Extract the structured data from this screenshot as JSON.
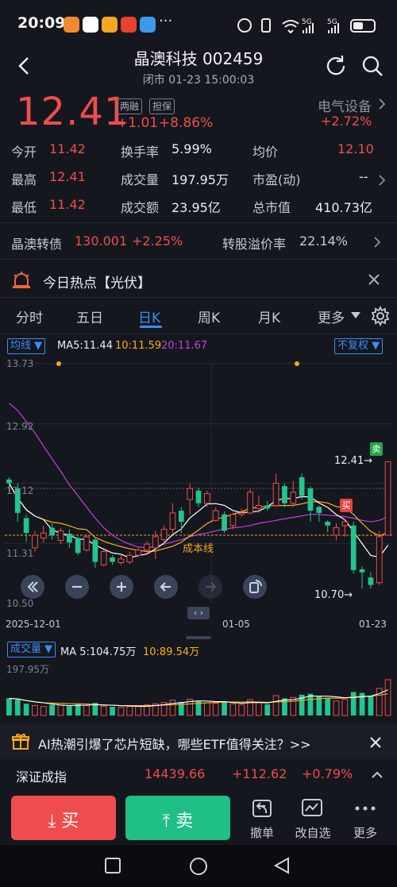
{
  "status_bar": {
    "time": "20:09",
    "battery": "5G"
  },
  "header": {
    "title": "晶澳科技 002459",
    "subtitle": "闭市 01-23 15:00:03"
  },
  "quote": {
    "price": "12.41",
    "change": "+1.01",
    "change_pct": "+8.86%",
    "tags": [
      "两融",
      "担保"
    ],
    "sector_name": "电气设备",
    "sector_change": "+2.72%",
    "stats": [
      {
        "label": "今开",
        "value": "11.42"
      },
      {
        "label": "换手率",
        "value": "5.99%"
      },
      {
        "label": "均价",
        "value": "12.10"
      },
      {
        "label": "最高",
        "value": "12.41"
      },
      {
        "label": "成交量",
        "value": "197.95万"
      },
      {
        "label": "市盈(动)",
        "value": "--"
      },
      {
        "label": "最低",
        "value": "11.42"
      },
      {
        "label": "成交额",
        "value": "23.95亿"
      },
      {
        "label": "总市值",
        "value": "410.73亿"
      }
    ]
  },
  "bond": {
    "label": "晶澳转债",
    "price": "130.001",
    "change": "+2.25%",
    "premium_label": "转股溢价率",
    "premium": "22.14%"
  },
  "hot": {
    "text": "今日热点【光伏】"
  },
  "tabs": [
    "分时",
    "五日",
    "日K",
    "周K",
    "月K",
    "更多"
  ],
  "active_tab": "日K",
  "chart": {
    "ma_selector": "均线",
    "ma5": "MA5:11.44",
    "ma10": "10:11.59",
    "ma20": "20:11.67",
    "fq_selector": "不复权",
    "y_ticks": [
      "13.73",
      "12.92",
      "12.12",
      "11.31",
      "10.50"
    ],
    "start_date": "2025-12-01",
    "mid_date": "01-05",
    "end_date": "01-23",
    "high_label": "12.41→",
    "low_label": "10.70→",
    "cost_line": "成本线",
    "sell_tag": "卖",
    "buy_tag": "买",
    "vol_selector": "成交量",
    "vol_ma5": "MA 5:104.75万",
    "vol_ma10": "10:89.54万",
    "vol_max": "197.95万"
  },
  "chart_data": {
    "type": "candlestick",
    "ylim": [
      10.5,
      13.73
    ],
    "candles": [
      {
        "o": 12.17,
        "c": 12.12,
        "h": 12.2,
        "l": 12.0
      },
      {
        "o": 12.05,
        "c": 11.72,
        "h": 12.12,
        "l": 11.6
      },
      {
        "o": 11.65,
        "c": 11.45,
        "h": 11.7,
        "l": 11.33
      },
      {
        "o": 11.25,
        "c": 11.42,
        "h": 11.48,
        "l": 11.2
      },
      {
        "o": 11.38,
        "c": 11.45,
        "h": 11.55,
        "l": 11.32
      },
      {
        "o": 11.52,
        "c": 11.42,
        "h": 11.58,
        "l": 11.36
      },
      {
        "o": 11.35,
        "c": 11.48,
        "h": 11.52,
        "l": 11.3
      },
      {
        "o": 11.44,
        "c": 11.32,
        "h": 11.5,
        "l": 11.25
      },
      {
        "o": 11.38,
        "c": 11.18,
        "h": 11.4,
        "l": 11.15
      },
      {
        "o": 11.22,
        "c": 11.4,
        "h": 11.43,
        "l": 11.2
      },
      {
        "o": 11.36,
        "c": 11.06,
        "h": 11.38,
        "l": 10.98
      },
      {
        "o": 11.02,
        "c": 11.2,
        "h": 11.22,
        "l": 11.0
      },
      {
        "o": 11.12,
        "c": 11.06,
        "h": 11.15,
        "l": 11.02
      },
      {
        "o": 11.05,
        "c": 11.1,
        "h": 11.15,
        "l": 11.02
      },
      {
        "o": 11.06,
        "c": 11.15,
        "h": 11.2,
        "l": 11.03
      },
      {
        "o": 11.15,
        "c": 11.22,
        "h": 11.25,
        "l": 11.12
      },
      {
        "o": 11.22,
        "c": 11.3,
        "h": 11.34,
        "l": 11.15
      },
      {
        "o": 11.25,
        "c": 11.4,
        "h": 11.48,
        "l": 11.1
      },
      {
        "o": 11.36,
        "c": 11.5,
        "h": 11.55,
        "l": 11.3
      },
      {
        "o": 11.5,
        "c": 11.72,
        "h": 11.85,
        "l": 11.45
      },
      {
        "o": 11.75,
        "c": 11.6,
        "h": 11.8,
        "l": 11.45
      },
      {
        "o": 11.9,
        "c": 12.05,
        "h": 12.12,
        "l": 11.7
      },
      {
        "o": 12.02,
        "c": 11.85,
        "h": 12.06,
        "l": 11.8
      },
      {
        "o": 11.85,
        "c": 11.98,
        "h": 12.02,
        "l": 11.8
      },
      {
        "o": 11.62,
        "c": 11.75,
        "h": 11.8,
        "l": 11.6
      },
      {
        "o": 11.7,
        "c": 11.48,
        "h": 11.74,
        "l": 11.45
      },
      {
        "o": 11.55,
        "c": 11.7,
        "h": 11.72,
        "l": 11.5
      },
      {
        "o": 11.7,
        "c": 11.72,
        "h": 11.78,
        "l": 11.66
      },
      {
        "o": 11.72,
        "c": 12.0,
        "h": 12.05,
        "l": 11.7
      },
      {
        "o": 11.78,
        "c": 11.82,
        "h": 11.95,
        "l": 11.72
      },
      {
        "o": 11.82,
        "c": 11.78,
        "h": 11.88,
        "l": 11.75
      },
      {
        "o": 11.82,
        "c": 12.12,
        "h": 12.25,
        "l": 11.8
      },
      {
        "o": 12.08,
        "c": 11.85,
        "h": 12.12,
        "l": 11.8
      },
      {
        "o": 11.85,
        "c": 12.0,
        "h": 12.15,
        "l": 11.8
      },
      {
        "o": 12.2,
        "c": 11.95,
        "h": 12.25,
        "l": 11.9
      },
      {
        "o": 12.05,
        "c": 11.75,
        "h": 12.08,
        "l": 11.6
      },
      {
        "o": 11.8,
        "c": 11.72,
        "h": 11.82,
        "l": 11.6
      },
      {
        "o": 11.6,
        "c": 11.55,
        "h": 11.62,
        "l": 11.46
      },
      {
        "o": 11.42,
        "c": 11.52,
        "h": 11.58,
        "l": 11.35
      },
      {
        "o": 11.55,
        "c": 11.6,
        "h": 11.64,
        "l": 11.4
      },
      {
        "o": 11.55,
        "c": 10.95,
        "h": 11.6,
        "l": 10.9
      },
      {
        "o": 10.96,
        "c": 10.92,
        "h": 11.0,
        "l": 10.7
      },
      {
        "o": 10.85,
        "c": 10.75,
        "h": 10.92,
        "l": 10.7
      },
      {
        "o": 10.78,
        "c": 11.4,
        "h": 11.48,
        "l": 10.75
      },
      {
        "o": 11.42,
        "c": 12.41,
        "h": 12.41,
        "l": 11.42
      }
    ],
    "volumes": [
      95,
      88,
      65,
      55,
      50,
      60,
      58,
      52,
      62,
      55,
      70,
      52,
      48,
      45,
      50,
      55,
      58,
      65,
      72,
      85,
      75,
      90,
      80,
      70,
      68,
      75,
      65,
      60,
      88,
      72,
      62,
      110,
      95,
      100,
      115,
      120,
      105,
      95,
      80,
      90,
      130,
      125,
      110,
      150,
      197.95
    ]
  },
  "ticker": {
    "text": "AI热潮引爆了芯片短缺，哪些ETF值得关注？>>",
    "index_name": "深证成指",
    "index_value": "14439.66",
    "index_change": "+112.62",
    "index_pct": "+0.79%"
  },
  "bottom": {
    "buy": "买",
    "sell": "卖",
    "tools": [
      "撤单",
      "改自选",
      "更多"
    ]
  },
  "colors": {
    "up": "#ef4d4d",
    "down": "#22c58f",
    "accent": "#3c8cf5",
    "ma5": "#ffffff",
    "ma10": "#f5b21c",
    "ma20": "#c040e0"
  }
}
